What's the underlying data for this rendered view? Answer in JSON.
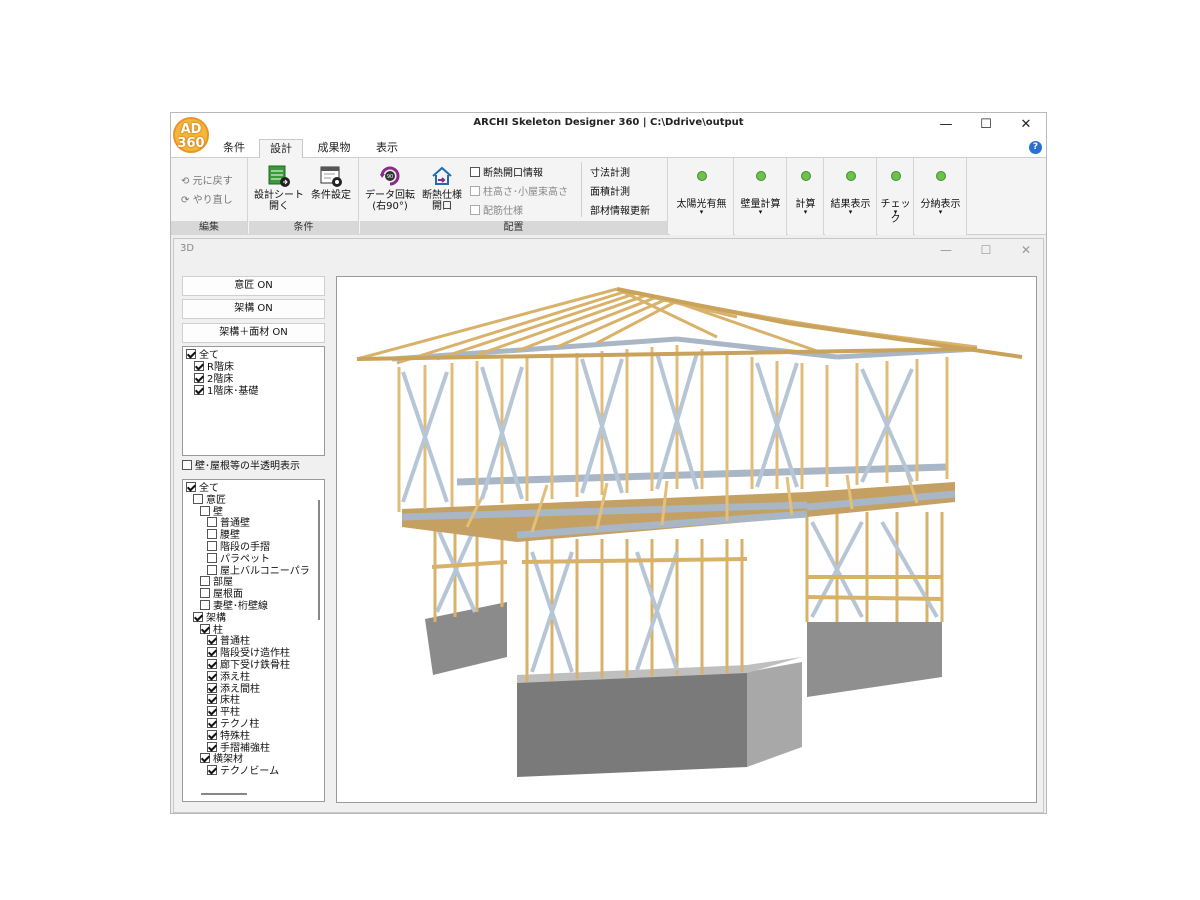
{
  "window": {
    "title": "ARCHI Skeleton Designer 360 | C:\\Ddrive\\output",
    "logo_text_1": "AD",
    "logo_text_2": "360",
    "minimize": "—",
    "maximize": "☐",
    "close": "✕"
  },
  "tabs": [
    {
      "label": "条件",
      "active": false
    },
    {
      "label": "設計",
      "active": true
    },
    {
      "label": "成果物",
      "active": false
    },
    {
      "label": "表示",
      "active": false
    }
  ],
  "ribbon": {
    "edit": {
      "undo": "元に戻す",
      "redo": "やり直し",
      "label": "編集"
    },
    "conditions": {
      "open_sheet_1": "設計シート",
      "open_sheet_2": "開く",
      "settings": "条件設定",
      "label": "条件"
    },
    "layout": {
      "rotate_1": "データ回転",
      "rotate_2": "(右90°)",
      "insulation_1": "断熱仕様",
      "insulation_2": "開口",
      "check_opening": "断熱開口情報",
      "check_height": "柱高さ･小屋束高さ",
      "check_rebar": "配筋仕様",
      "dim": "寸法計測",
      "area": "面積計測",
      "update": "部材情報更新",
      "label": "配置"
    },
    "status": [
      {
        "label": "太陽光有無",
        "color": "#6cc24a"
      },
      {
        "label": "壁量計算",
        "color": "#6cc24a"
      },
      {
        "label": "計算",
        "color": "#6cc24a"
      },
      {
        "label": "結果表示",
        "color": "#6cc24a"
      },
      {
        "label": "チェック",
        "color": "#6cc24a"
      },
      {
        "label": "分納表示",
        "color": "#6cc24a"
      }
    ],
    "arrow": "▾"
  },
  "subwindow": {
    "title": "3D",
    "minimize": "—",
    "maximize": "☐",
    "close": "✕"
  },
  "panel": {
    "btn_design": "意匠 ON",
    "btn_frame": "架構 ON",
    "btn_frame_surface": "架構＋面材 ON",
    "floors": [
      {
        "label": "全て",
        "checked": true,
        "indent": 0
      },
      {
        "label": "R階床",
        "checked": true,
        "indent": 1
      },
      {
        "label": "2階床",
        "checked": true,
        "indent": 1
      },
      {
        "label": "1階床･基礎",
        "checked": true,
        "indent": 1
      }
    ],
    "translucent": "壁･屋根等の半透明表示",
    "layers": [
      {
        "label": "全て",
        "checked": true,
        "indent": 0
      },
      {
        "label": "意匠",
        "checked": false,
        "indent": 1
      },
      {
        "label": "壁",
        "checked": false,
        "indent": 2
      },
      {
        "label": "普通壁",
        "checked": false,
        "indent": 3
      },
      {
        "label": "腰壁",
        "checked": false,
        "indent": 3
      },
      {
        "label": "階段の手摺",
        "checked": false,
        "indent": 3
      },
      {
        "label": "パラペット",
        "checked": false,
        "indent": 3
      },
      {
        "label": "屋上バルコニーパラ",
        "checked": false,
        "indent": 3
      },
      {
        "label": "部屋",
        "checked": false,
        "indent": 2
      },
      {
        "label": "屋根面",
        "checked": false,
        "indent": 2
      },
      {
        "label": "妻壁･桁壁線",
        "checked": false,
        "indent": 2
      },
      {
        "label": "架構",
        "checked": true,
        "indent": 1
      },
      {
        "label": "柱",
        "checked": true,
        "indent": 2
      },
      {
        "label": "普通柱",
        "checked": true,
        "indent": 3
      },
      {
        "label": "階段受け造作柱",
        "checked": true,
        "indent": 3
      },
      {
        "label": "廊下受け鉄骨柱",
        "checked": true,
        "indent": 3
      },
      {
        "label": "添え柱",
        "checked": true,
        "indent": 3
      },
      {
        "label": "添え間柱",
        "checked": true,
        "indent": 3
      },
      {
        "label": "床柱",
        "checked": true,
        "indent": 3
      },
      {
        "label": "平柱",
        "checked": true,
        "indent": 3
      },
      {
        "label": "テクノ柱",
        "checked": true,
        "indent": 3
      },
      {
        "label": "特殊柱",
        "checked": true,
        "indent": 3
      },
      {
        "label": "手摺補強柱",
        "checked": true,
        "indent": 3
      },
      {
        "label": "横架材",
        "checked": true,
        "indent": 2
      },
      {
        "label": "テクノビーム",
        "checked": true,
        "indent": 3
      }
    ]
  }
}
